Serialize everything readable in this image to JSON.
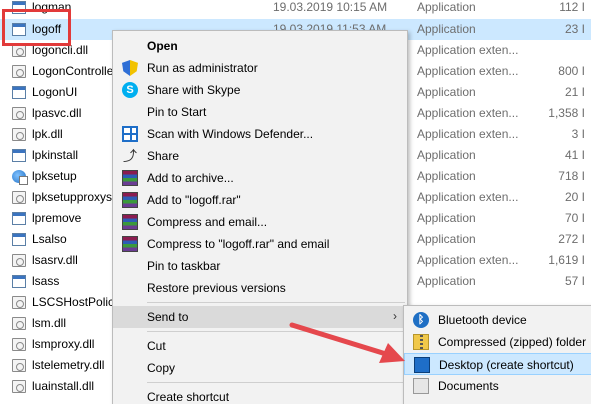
{
  "files": [
    {
      "name": "logman",
      "date": "19.03.2019 10:15 AM",
      "type": "Application",
      "size": "112 I",
      "icon": "app-icon",
      "selected": false
    },
    {
      "name": "logoff",
      "date": "19.03.2019 11:53 AM",
      "type": "Application",
      "size": "23 I",
      "icon": "app-icon",
      "selected": true
    },
    {
      "name": "logoncli.dll",
      "date": "",
      "type": "Application exten...",
      "size": "",
      "icon": "dll-icon",
      "selected": false
    },
    {
      "name": "LogonController",
      "date": "",
      "type": "Application exten...",
      "size": "800 I",
      "icon": "dll-icon",
      "selected": false
    },
    {
      "name": "LogonUI",
      "date": "",
      "type": "Application",
      "size": "21 I",
      "icon": "app-icon",
      "selected": false
    },
    {
      "name": "lpasvc.dll",
      "date": "",
      "type": "Application exten...",
      "size": "1,358 I",
      "icon": "dll-icon",
      "selected": false
    },
    {
      "name": "lpk.dll",
      "date": "",
      "type": "Application exten...",
      "size": "3 I",
      "icon": "dll-icon",
      "selected": false
    },
    {
      "name": "lpkinstall",
      "date": "",
      "type": "Application",
      "size": "41 I",
      "icon": "app-icon",
      "selected": false
    },
    {
      "name": "lpksetup",
      "date": "",
      "type": "Application",
      "size": "718 I",
      "icon": "globe-icon",
      "selected": false
    },
    {
      "name": "lpksetupproxyse",
      "date": "",
      "type": "Application exten...",
      "size": "20 I",
      "icon": "dll-icon",
      "selected": false
    },
    {
      "name": "lpremove",
      "date": "",
      "type": "Application",
      "size": "70 I",
      "icon": "app-icon",
      "selected": false
    },
    {
      "name": "Lsalso",
      "date": "",
      "type": "Application",
      "size": "272 I",
      "icon": "app-icon",
      "selected": false
    },
    {
      "name": "lsasrv.dll",
      "date": "",
      "type": "Application exten...",
      "size": "1,619 I",
      "icon": "dll-icon",
      "selected": false
    },
    {
      "name": "lsass",
      "date": "",
      "type": "Application",
      "size": "57 I",
      "icon": "app-icon",
      "selected": false
    },
    {
      "name": "LSCSHostPolicy",
      "date": "",
      "type": "",
      "size": "",
      "icon": "dll-icon",
      "selected": false
    },
    {
      "name": "lsm.dll",
      "date": "",
      "type": "",
      "size": "",
      "icon": "dll-icon",
      "selected": false
    },
    {
      "name": "lsmproxy.dll",
      "date": "",
      "type": "",
      "size": "",
      "icon": "dll-icon",
      "selected": false
    },
    {
      "name": "lstelemetry.dll",
      "date": "",
      "type": "",
      "size": "",
      "icon": "dll-icon",
      "selected": false
    },
    {
      "name": "luainstall.dll",
      "date": "",
      "type": "",
      "size": "",
      "icon": "dll-icon",
      "selected": false
    }
  ],
  "context_menu": {
    "items": [
      {
        "label": "Open",
        "icon": "",
        "bold": true
      },
      {
        "label": "Run as administrator",
        "icon": "shield-icon"
      },
      {
        "label": "Share with Skype",
        "icon": "skype-icon"
      },
      {
        "label": "Pin to Start",
        "icon": ""
      },
      {
        "label": "Scan with Windows Defender...",
        "icon": "defender-icon"
      },
      {
        "label": "Share",
        "icon": "share-icon"
      },
      {
        "label": "Add to archive...",
        "icon": "winrar-icon"
      },
      {
        "label": "Add to \"logoff.rar\"",
        "icon": "winrar-icon"
      },
      {
        "label": "Compress and email...",
        "icon": "winrar-icon"
      },
      {
        "label": "Compress to \"logoff.rar\" and email",
        "icon": "winrar-icon"
      },
      {
        "label": "Pin to taskbar",
        "icon": ""
      },
      {
        "label": "Restore previous versions",
        "icon": ""
      },
      {
        "label": "Send to",
        "icon": "",
        "submenu": true
      },
      {
        "label": "Cut",
        "icon": ""
      },
      {
        "label": "Copy",
        "icon": ""
      },
      {
        "label": "Create shortcut",
        "icon": ""
      }
    ]
  },
  "send_to_menu": {
    "items": [
      {
        "label": "Bluetooth device",
        "icon": "bluetooth-icon"
      },
      {
        "label": "Compressed (zipped) folder",
        "icon": "zip-folder-icon"
      },
      {
        "label": "Desktop (create shortcut)",
        "icon": "desktop-icon",
        "highlighted": true
      },
      {
        "label": "Documents",
        "icon": "documents-icon"
      }
    ]
  },
  "colors": {
    "highlight_box": "#e23a3a",
    "arrow": "#e5484d",
    "selection": "#cce8ff"
  }
}
